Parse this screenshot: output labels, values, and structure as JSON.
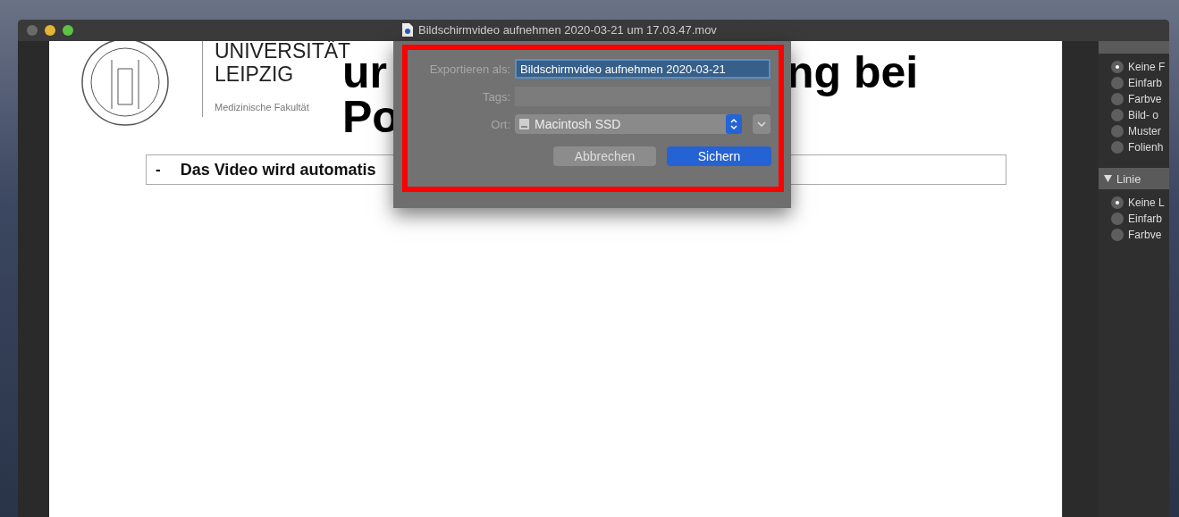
{
  "window": {
    "title": "Bildschirmvideo aufnehmen 2020-03-21 um 17.03.47.mov"
  },
  "slide": {
    "university_lines": [
      "UNIVERSITÄT",
      "LEIPZIG"
    ],
    "faculty": "Medizinische Fakultät",
    "title_parts": [
      "ur",
      "ng bei",
      "Po"
    ],
    "bullet_marker": "-",
    "bullet_text": "Das Video wird automatis"
  },
  "dialog": {
    "export_label": "Exportieren als:",
    "export_value": "Bildschirmvideo aufnehmen 2020-03-21",
    "tags_label": "Tags:",
    "location_label": "Ort:",
    "location_value": "Macintosh SSD",
    "buttons": [
      {
        "label": "Abbrechen",
        "kind": "cancel"
      },
      {
        "label": "Sichern",
        "kind": "default"
      }
    ]
  },
  "panel": {
    "sections": [
      {
        "options": [
          {
            "label": "Keine F",
            "selected": true
          },
          {
            "label": "Einfarb",
            "selected": false
          },
          {
            "label": "Farbve",
            "selected": false
          },
          {
            "label": "Bild- o",
            "selected": false
          },
          {
            "label": "Muster",
            "selected": false
          },
          {
            "label": "Folienh",
            "selected": false
          }
        ]
      },
      {
        "title": "Linie",
        "options": [
          {
            "label": "Keine L",
            "selected": true
          },
          {
            "label": "Einfarb",
            "selected": false
          },
          {
            "label": "Farbve",
            "selected": false
          }
        ]
      }
    ]
  }
}
